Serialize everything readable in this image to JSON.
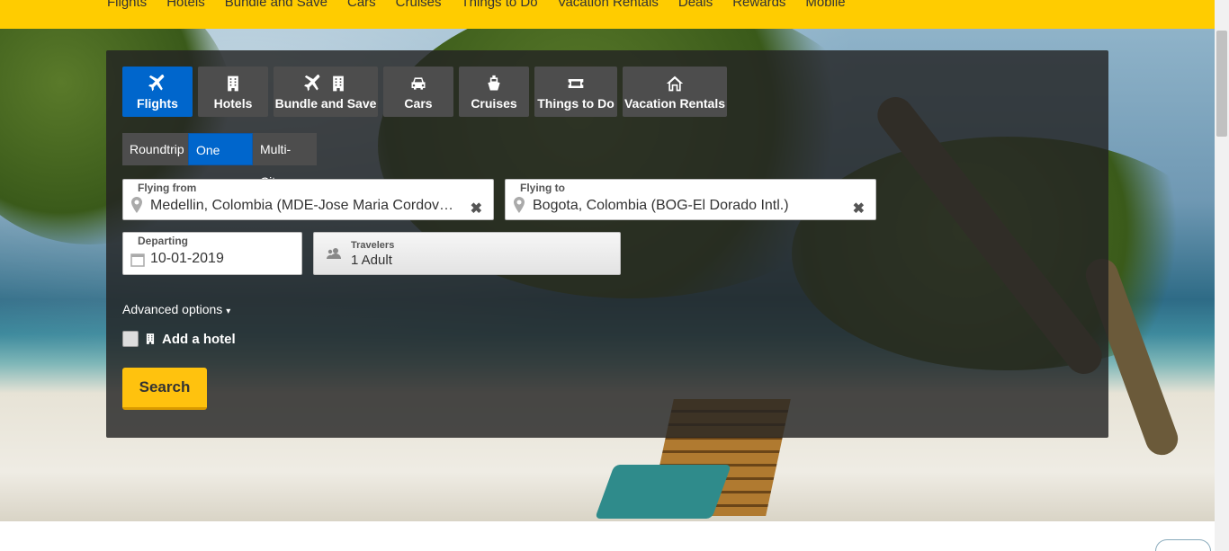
{
  "topnav": {
    "links": [
      "Flights",
      "Hotels",
      "Bundle and Save",
      "Cars",
      "Cruises",
      "Things to Do",
      "Vacation Rentals",
      "Deals",
      "Rewards",
      "Mobile"
    ]
  },
  "tabs": [
    {
      "label": "Flights",
      "icon": "airplane-icon",
      "active": true
    },
    {
      "label": "Hotels",
      "icon": "building-icon",
      "active": false
    },
    {
      "label": "Bundle and Save",
      "icon": "airplane-building-icon",
      "active": false
    },
    {
      "label": "Cars",
      "icon": "car-icon",
      "active": false
    },
    {
      "label": "Cruises",
      "icon": "ship-icon",
      "active": false
    },
    {
      "label": "Things to Do",
      "icon": "ticket-icon",
      "active": false
    },
    {
      "label": "Vacation Rentals",
      "icon": "house-icon",
      "active": false
    }
  ],
  "trip_type": {
    "options": [
      "Roundtrip",
      "One way",
      "Multi-City"
    ],
    "selected": "One way"
  },
  "flying_from": {
    "label": "Flying from",
    "value": "Medellin, Colombia (MDE-Jose Maria Cordova Intl.)"
  },
  "flying_to": {
    "label": "Flying to",
    "value": "Bogota, Colombia (BOG-El Dorado Intl.)"
  },
  "departing": {
    "label": "Departing",
    "value": "10-01-2019"
  },
  "travelers": {
    "label": "Travelers",
    "value": "1 Adult"
  },
  "advanced_options": "Advanced options",
  "add_hotel": "Add a hotel",
  "search_button": "Search",
  "colors": {
    "nav_yellow": "#ffcc00",
    "active_blue": "#0066cc",
    "search_yellow": "#ffc20e"
  }
}
